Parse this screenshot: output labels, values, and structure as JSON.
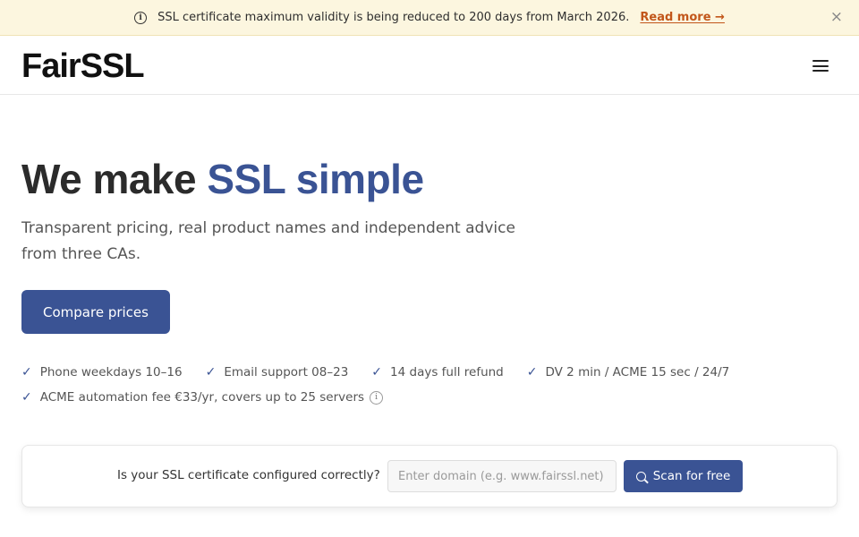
{
  "banner": {
    "message": "SSL certificate maximum validity is being reduced to 200 days from March 2026.",
    "link_label": "Read more →",
    "close_glyph": "×"
  },
  "header": {
    "logo": "FairSSL"
  },
  "hero": {
    "title_main": "We make ",
    "title_accent": "SSL simple",
    "subtitle": "Transparent pricing, real product names and independent advice from three CAs.",
    "cta_label": "Compare prices"
  },
  "features": [
    "Phone weekdays 10–16",
    "Email support 08–23",
    "14 days full refund",
    "DV 2 min / ACME 15 sec / 24/7",
    "ACME automation fee €33/yr, covers up to 25 servers"
  ],
  "scan": {
    "question": "Is your SSL certificate configured correctly?",
    "placeholder": "Enter domain (e.g. www.fairssl.net)",
    "button_label": "Scan for free"
  },
  "colors": {
    "accent": "#3a5394",
    "banner_bg": "#fcf6df",
    "link": "#c2561a"
  }
}
